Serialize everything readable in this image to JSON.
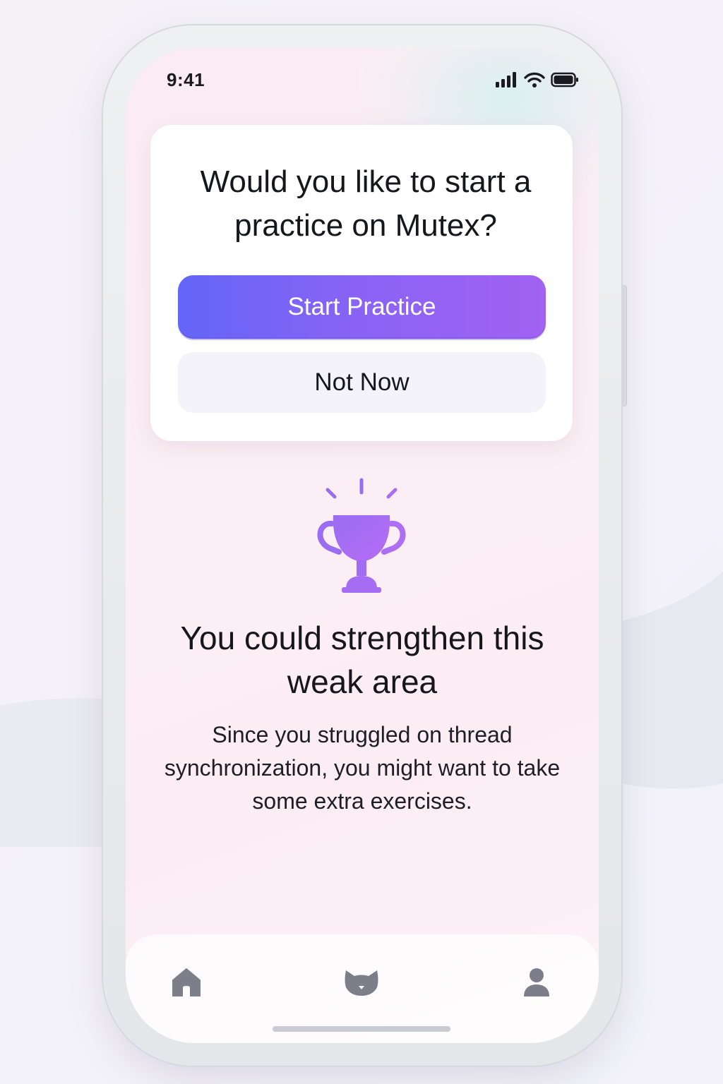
{
  "status_bar": {
    "time": "9:41",
    "icons": [
      "signal-icon",
      "wifi-icon",
      "battery-icon"
    ]
  },
  "prompt_card": {
    "title": "Would you like to start a practice on Mutex?",
    "primary_button": "Start Practice",
    "secondary_button": "Not Now"
  },
  "encouragement": {
    "icon": "trophy-icon",
    "headline": "You could strengthen this weak area",
    "message": "Since you struggled on thread synchronization, you might want to take some extra exercises."
  },
  "tab_bar": {
    "items": [
      "home-icon",
      "cat-icon",
      "profile-icon"
    ]
  },
  "colors": {
    "accent_start": "#6366f7",
    "accent_end": "#a262f2",
    "tab_icon": "#7c7f8a",
    "trophy": "#a76cf3"
  }
}
